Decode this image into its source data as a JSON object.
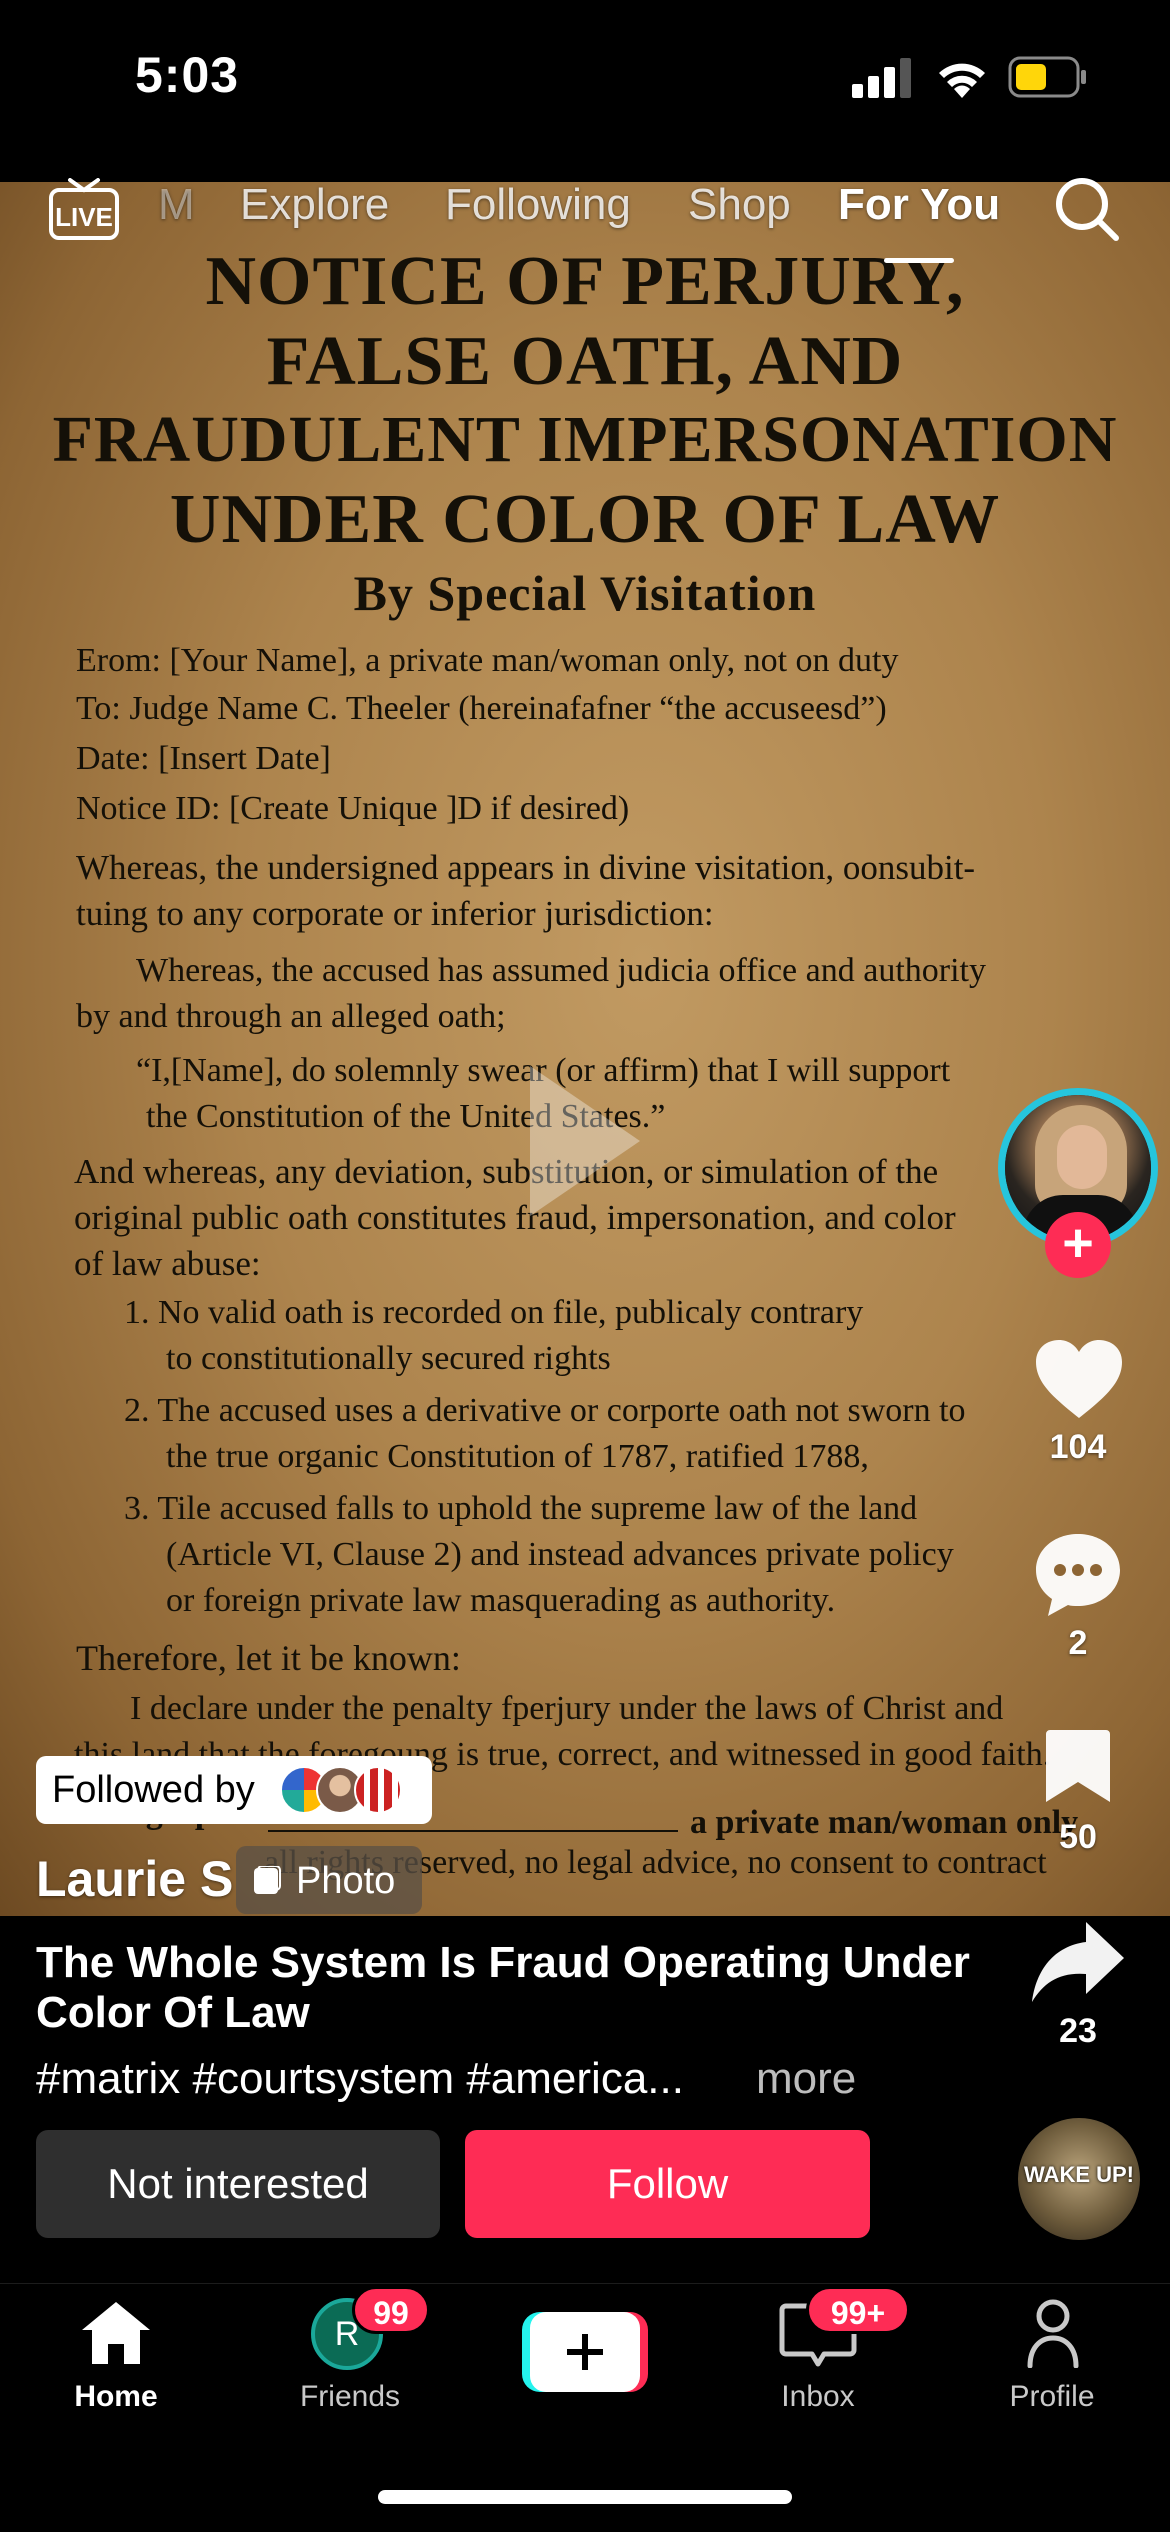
{
  "status_bar": {
    "time": "5:03"
  },
  "top_nav": {
    "live_label": "LIVE",
    "tabs": [
      {
        "label": "M"
      },
      {
        "label": "Explore"
      },
      {
        "label": "Following"
      },
      {
        "label": "Shop"
      },
      {
        "label": "For You"
      }
    ],
    "active_tab": "For You"
  },
  "document": {
    "heading": [
      "NOTICE OF PERJURY,",
      "FALSE OATH, AND",
      "FRAUDULENT IMPERSONATION",
      "UNDER COLOR OF LAW"
    ],
    "subheading": "By Special Visitation",
    "lines": [
      "Erom: [Your Name], a private man/woman only, not on duty",
      "To: Judge Name C. Theeler (hereinafafner “the  accuseesd”)",
      "Date:  [Insert Date]",
      "Notice ID:  [Create Unique ]D if  desired)",
      "Whereas, the undersigned appears in divine visitation, oonsubit-",
      "tuing to any corporate or inferior jurisdiction:",
      "Whereas, the accused has assumed judicia office and authority",
      "by and through an alleged oath;",
      "“I,[Name], do solemnly swear (or affirm) that I will support",
      "the Constitution of the United States.”",
      "And whereas, any deviation, substitution, or simulation of the",
      "original public oath constitutes fraud, impersonation, and color",
      "of law abuse:",
      "1.  No valid oath is recorded on file, publicaly contrary",
      "to constitutionally secured rights",
      "2.  The accused uses a derivative or corporte oath not sworn to",
      "the true organic Constitution of 1787, ratified 1788,",
      "3.  Tile accused falls to uphold the supreme law of the land",
      "(Article VI, Clause 2) and instead advances private policy",
      "or foreign private law masquerading as authority.",
      "Therefore, let it be known:",
      "I declare under the penalty fperjury under the laws of Christ and",
      "this land that the foregoung is true, correct, and witnessed in good faith.",
      "Autograph",
      "a private man/woman only",
      "all rights reserved, no legal advice, no consent to contract"
    ]
  },
  "rail": {
    "likes": "104",
    "comments": "2",
    "saves": "50",
    "shares": "23"
  },
  "followed_by_label": "Followed by",
  "author": "Laurie S",
  "photo_chip": "Photo",
  "caption_title": "The Whole System Is Fraud Operating Under Color Of Law",
  "hashtags": "#matrix #courtsystem #america...",
  "more_label": "more",
  "buttons": {
    "not_interested": "Not interested",
    "follow": "Follow"
  },
  "music_disc_text": "WAKE UP!",
  "tab_bar": {
    "home": "Home",
    "friends": "Friends",
    "friends_avatar_letter": "R",
    "friends_badge": "99",
    "inbox": "Inbox",
    "inbox_badge": "99+",
    "profile": "Profile"
  },
  "colors": {
    "accent": "#fe2c55",
    "avatar_ring": "#26c5dd",
    "create_cyan": "#25f4ee"
  }
}
